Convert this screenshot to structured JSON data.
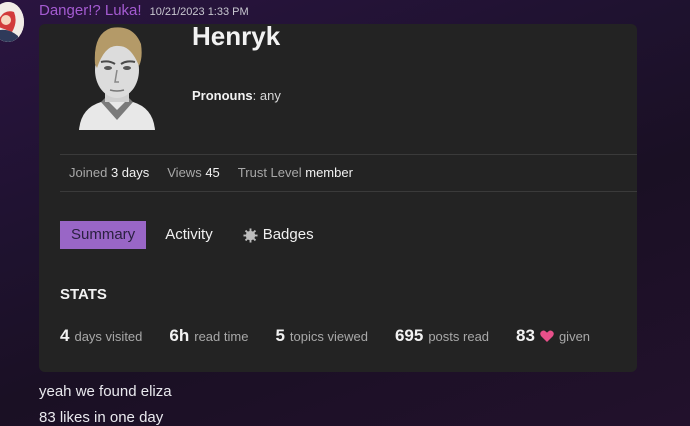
{
  "message": {
    "author": "Danger!? Luka!",
    "timestamp": "10/21/2023 1:33 PM",
    "lines": [
      "yeah we found eliza",
      "83 likes in one day"
    ]
  },
  "profile": {
    "username": "Henryk",
    "pronouns_label": "Pronouns",
    "pronouns_value": ": any",
    "meta": {
      "joined_label": "Joined",
      "joined_value": "3 days",
      "views_label": "Views",
      "views_value": "45",
      "trust_label": "Trust Level",
      "trust_value": "member"
    },
    "tabs": [
      {
        "label": "Summary",
        "active": true
      },
      {
        "label": "Activity",
        "active": false
      },
      {
        "label": "Badges",
        "active": false,
        "icon": "badge-gear-icon"
      }
    ],
    "stats_title": "STATS",
    "stats": [
      {
        "value": "4",
        "label": "days visited"
      },
      {
        "value": "6h",
        "label": "read time"
      },
      {
        "value": "5",
        "label": "topics viewed"
      },
      {
        "value": "695",
        "label": "posts read"
      },
      {
        "value": "83",
        "label": "given",
        "icon": "heart-icon"
      }
    ]
  },
  "colors": {
    "author": "#a45bd1",
    "active_tab": "#9966c6",
    "heart": "#e8508a",
    "card": "#232323"
  }
}
